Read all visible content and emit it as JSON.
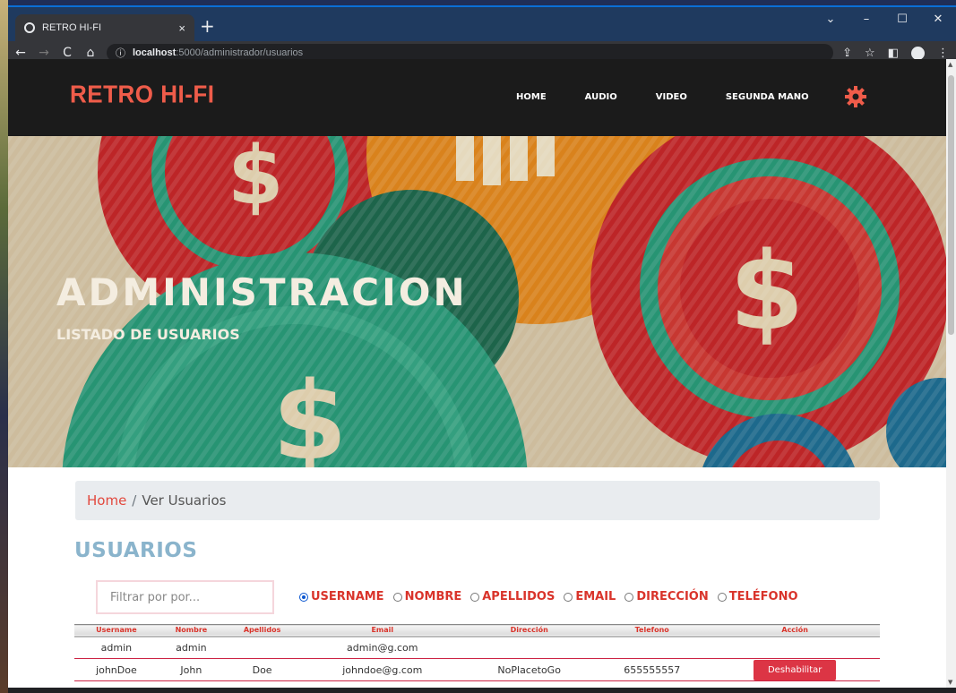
{
  "browser": {
    "tab_title": "RETRO HI-FI",
    "tab_close": "×",
    "new_tab": "+",
    "url_host": "localhost",
    "url_path": ":5000/administrador/usuarios"
  },
  "site": {
    "brand": "RETRO HI-FI",
    "menu": [
      "HOME",
      "AUDIO",
      "VIDEO",
      "SEGUNDA MANO"
    ]
  },
  "hero": {
    "title": "ADMINISTRACION",
    "subtitle": "LISTADO DE USUARIOS"
  },
  "breadcrumb": {
    "home": "Home",
    "sep": "/",
    "current": "Ver Usuarios"
  },
  "section_title": "USUARIOS",
  "filter": {
    "placeholder": "Filtrar por por...",
    "options": [
      "USERNAME",
      "NOMBRE",
      "APELLIDOS",
      "EMAIL",
      "DIRECCIÓN",
      "TELÉFONO"
    ],
    "selected": "USERNAME"
  },
  "table": {
    "headers": [
      "Username",
      "Nombre",
      "Apellidos",
      "Email",
      "Dirección",
      "Telefono",
      "Acción"
    ],
    "rows": [
      [
        "admin",
        "admin",
        "",
        "admin@g.com",
        "",
        "",
        ""
      ],
      [
        "johnDoe",
        "John",
        "Doe",
        "johndoe@g.com",
        "NoPlacetoGo",
        "655555557",
        "Deshabilitar"
      ]
    ]
  },
  "colors": {
    "brand": "#ef5c4a",
    "accent_red": "#d9342b",
    "section_title": "#8ab4cc"
  }
}
